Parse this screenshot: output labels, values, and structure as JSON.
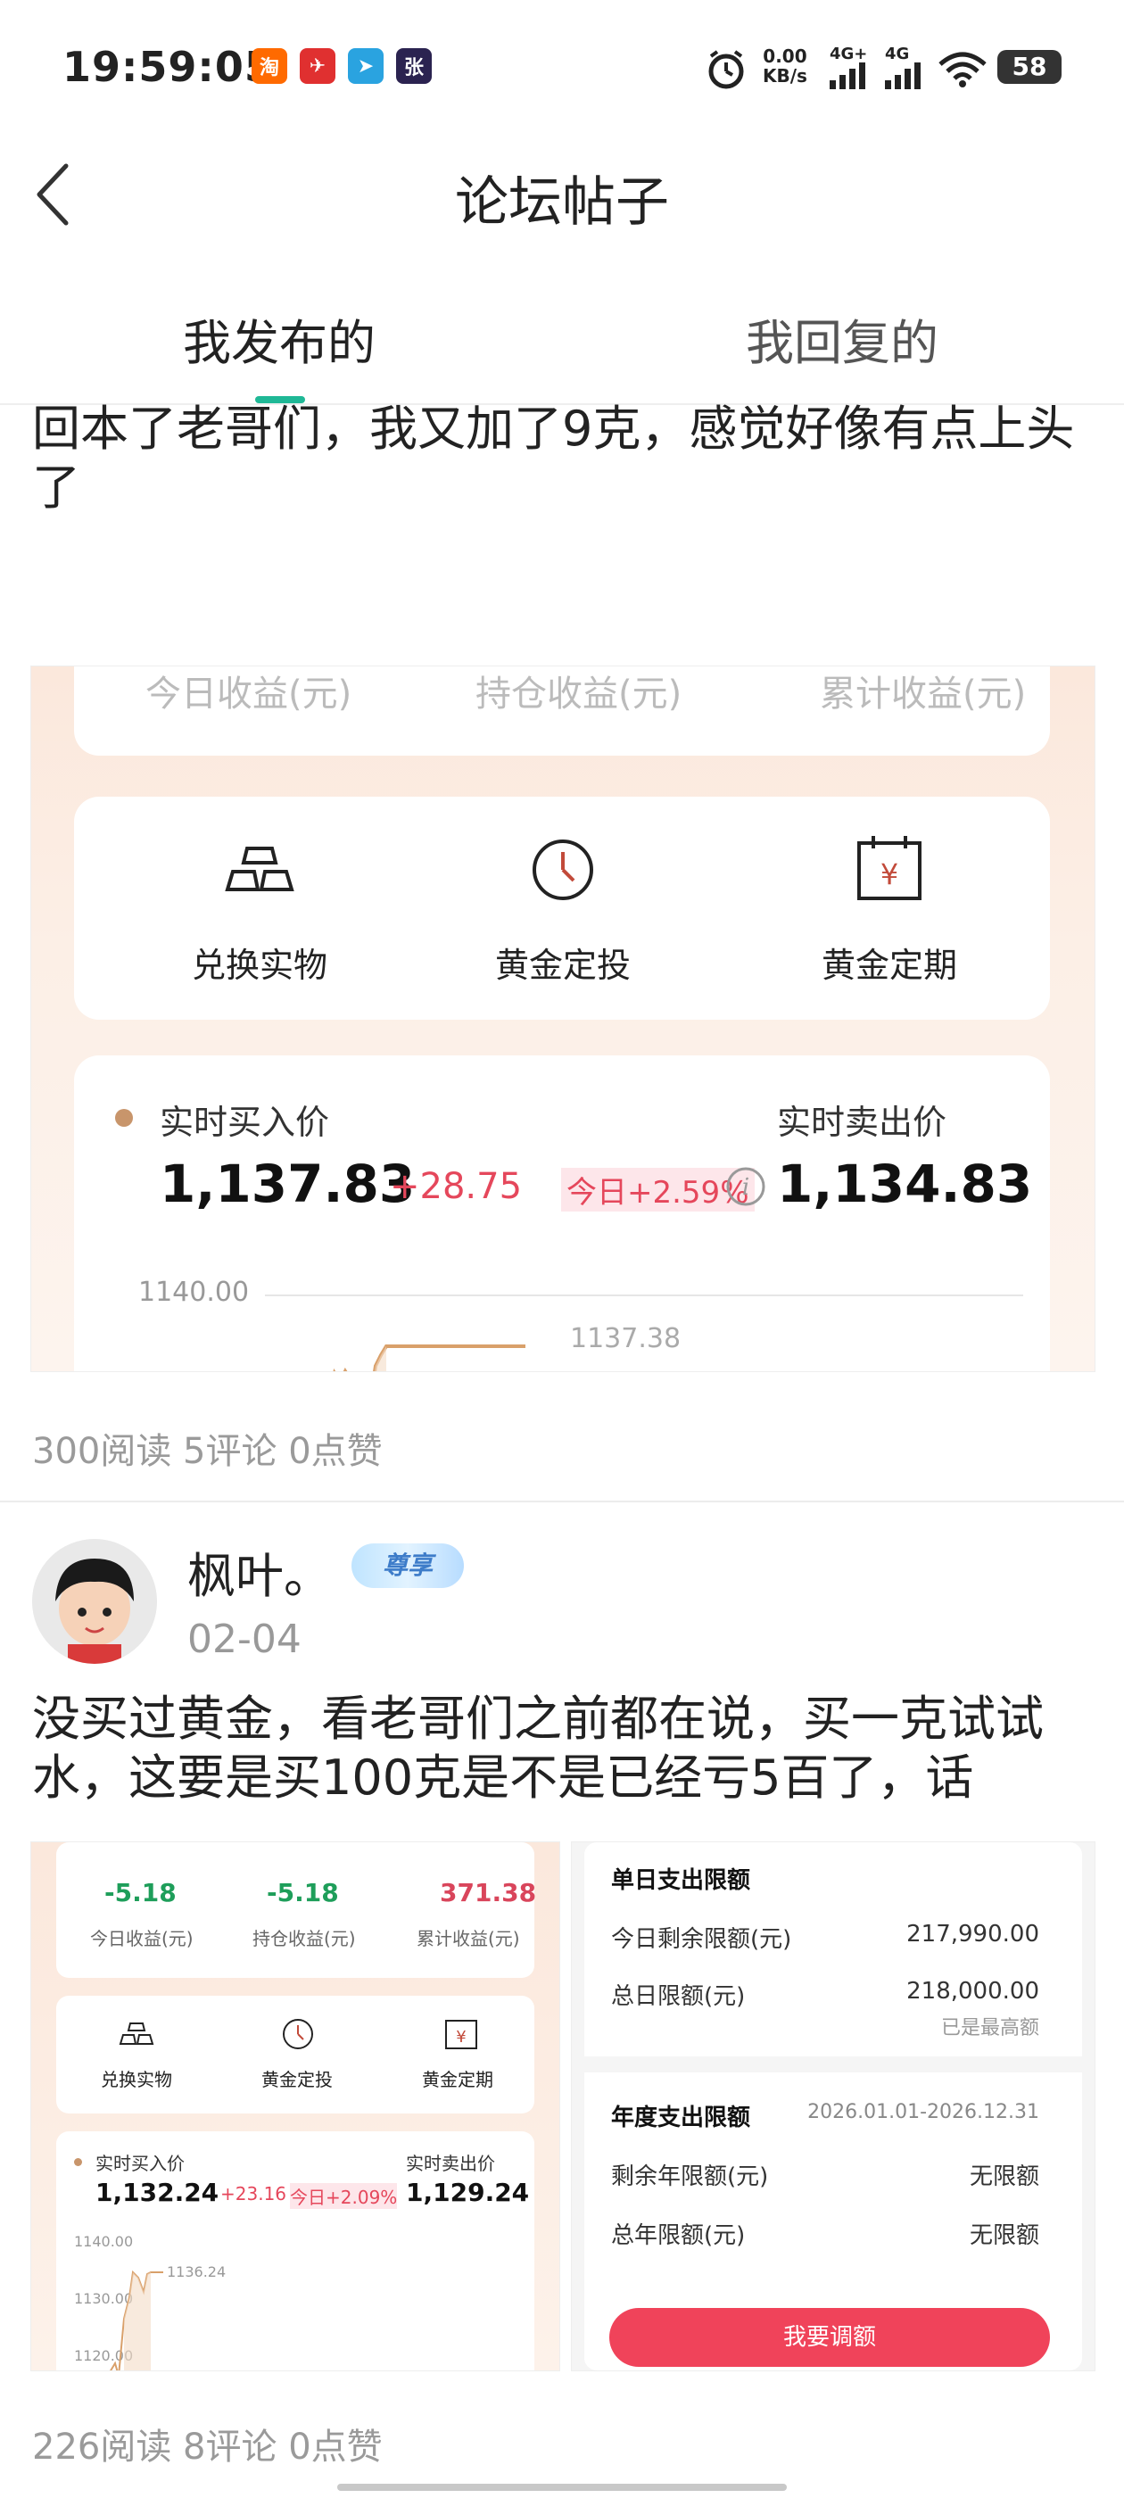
{
  "status_bar": {
    "time": "19:59:05",
    "app_icons": [
      {
        "name": "taobao-app-icon",
        "glyph": "淘",
        "color": "#ff6a00"
      },
      {
        "name": "bank-app-icon",
        "glyph": "✈",
        "color": "#e03030"
      },
      {
        "name": "telegram-app-icon",
        "glyph": "➤",
        "color": "#2aa3e0"
      },
      {
        "name": "notes-app-icon",
        "glyph": "张",
        "color": "#2b2350"
      }
    ],
    "net_speed": "0.00",
    "net_unit": "KB/s",
    "signal1": "4G+",
    "signal2": "4G",
    "battery": "58"
  },
  "nav": {
    "title": "论坛帖子",
    "tabs": [
      {
        "label": "我发布的"
      },
      {
        "label": "我回复的"
      }
    ]
  },
  "posts": [
    {
      "text": "回本了老哥们，我又加了9克，感觉好像有点上头了",
      "stats": "300阅读 5评论 0点赞",
      "image": {
        "top_labels": [
          "今日收益(元)",
          "持仓收益(元)",
          "累计收益(元)"
        ],
        "actions": [
          "兑换实物",
          "黄金定投",
          "黄金定期"
        ],
        "buy_label": "实时买入价",
        "sell_label": "实时卖出价",
        "buy_price": "1,137.83",
        "change": "+28.75",
        "today_change": "今日+2.59%",
        "sell_price": "1,134.83",
        "axis_top": "1140.00",
        "current_marker": "1137.38"
      }
    },
    {
      "author": "枫叶。",
      "badge": "尊享",
      "date": "02-04",
      "text": "没买过黄金，看老哥们之前都在说，买一克试试水，这要是买100克是不是已经亏5百了，话",
      "stats": "226阅读 8评论 0点赞",
      "image_left": {
        "values": [
          "-5.18",
          "-5.18",
          "371.38"
        ],
        "value_labels": [
          "今日收益(元)",
          "持仓收益(元)",
          "累计收益(元)"
        ],
        "actions": [
          "兑换实物",
          "黄金定投",
          "黄金定期"
        ],
        "buy_label": "实时买入价",
        "sell_label": "实时卖出价",
        "buy_price": "1,132.24",
        "change": "+23.16",
        "today_change": "今日+2.09%",
        "sell_price": "1,129.24",
        "axis": [
          "1140.00",
          "1130.00",
          "1120.00"
        ],
        "current_marker": "1136.24"
      },
      "image_right": {
        "daily_title": "单日支出限额",
        "rows_daily": [
          {
            "label": "今日剩余限额(元)",
            "value": "217,990.00"
          },
          {
            "label": "总日限额(元)",
            "value": "218,000.00"
          }
        ],
        "daily_note": "已是最高额",
        "yearly_title": "年度支出限额",
        "yearly_range": "2026.01.01-2026.12.31",
        "rows_yearly": [
          {
            "label": "剩余年限额(元)",
            "value": "无限额"
          },
          {
            "label": "总年限额(元)",
            "value": "无限额"
          }
        ],
        "button": "我要调额"
      }
    }
  ]
}
